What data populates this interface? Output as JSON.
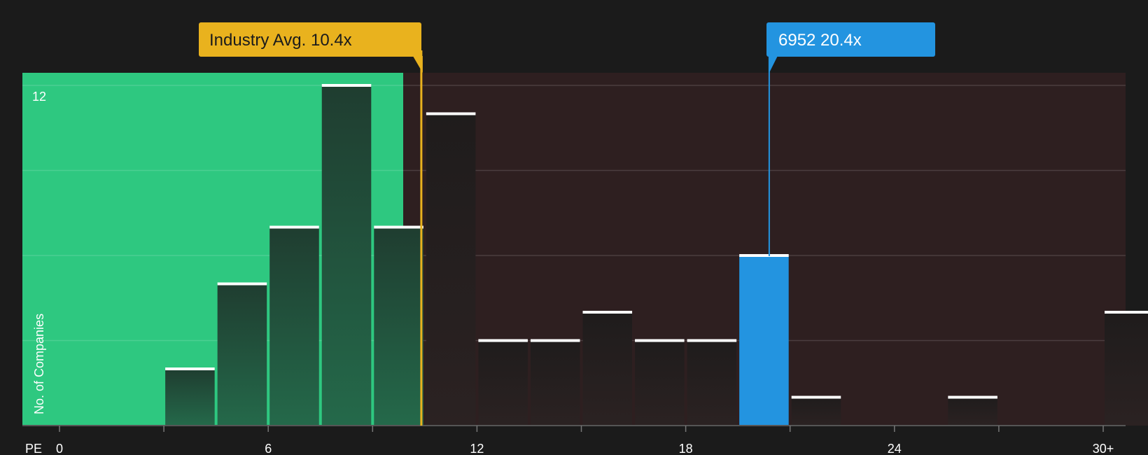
{
  "chart_data": {
    "type": "bar",
    "title": "",
    "xlabel": "PE",
    "ylabel": "No. of Companies",
    "x_tick_labels": [
      "0",
      "6",
      "12",
      "18",
      "24",
      "30+"
    ],
    "x_tick_values": [
      0,
      6,
      12,
      18,
      24,
      30
    ],
    "x_range": [
      0,
      31
    ],
    "ylim": [
      0,
      12
    ],
    "y_tick_label": "12",
    "bin_width": 1.5,
    "bins": [
      {
        "start": 3.0,
        "count": 2
      },
      {
        "start": 4.5,
        "count": 5
      },
      {
        "start": 6.0,
        "count": 7
      },
      {
        "start": 7.5,
        "count": 12
      },
      {
        "start": 9.0,
        "count": 7
      },
      {
        "start": 10.5,
        "count": 11
      },
      {
        "start": 12.0,
        "count": 3
      },
      {
        "start": 13.5,
        "count": 3
      },
      {
        "start": 15.0,
        "count": 4
      },
      {
        "start": 16.5,
        "count": 3
      },
      {
        "start": 18.0,
        "count": 3
      },
      {
        "start": 19.5,
        "count": 6,
        "highlight": true
      },
      {
        "start": 21.0,
        "count": 1
      },
      {
        "start": 25.5,
        "count": 1
      },
      {
        "start": 30.0,
        "count": 4
      }
    ],
    "industry_avg": {
      "label": "Industry Avg. 10.4x",
      "value": 10.4
    },
    "company": {
      "label": "6952 20.4x",
      "value": 20.4
    },
    "fair_zone_end": 9.9,
    "gridlines": true,
    "colors": {
      "background": "#1b1b1b",
      "fair_zone": "#2ec880",
      "expensive_zone": "#2e1f20",
      "bar_in_fair": "#1e4a35",
      "bar_in_expensive": "#231f1f",
      "highlight_bar": "#2394e0",
      "industry_callout": "#e9b21e",
      "company_callout": "#2394e0",
      "cap_line": "#ffffff",
      "text": "#ffffff"
    }
  }
}
